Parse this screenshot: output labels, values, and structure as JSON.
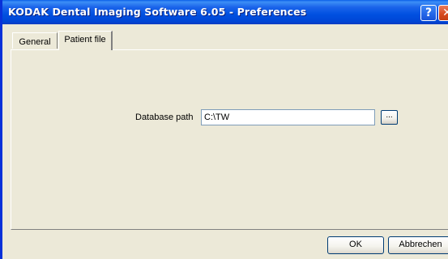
{
  "window": {
    "title": "KODAK Dental Imaging Software 6.05 - Preferences",
    "help_glyph": "?",
    "close_glyph": "✕"
  },
  "tabs": [
    {
      "label": "General",
      "selected": false
    },
    {
      "label": "Patient file",
      "selected": true
    }
  ],
  "patient_file": {
    "database_path_label": "Database path",
    "database_path_value": "C:\\TW",
    "browse_label": "..."
  },
  "buttons": {
    "ok": "OK",
    "cancel": "Abbrechen"
  },
  "icons": [
    "help-icon",
    "close-icon"
  ],
  "colors": {
    "titlebar": "#0050e0",
    "dialog_bg": "#ece9d8",
    "close_button": "#d6481d"
  }
}
